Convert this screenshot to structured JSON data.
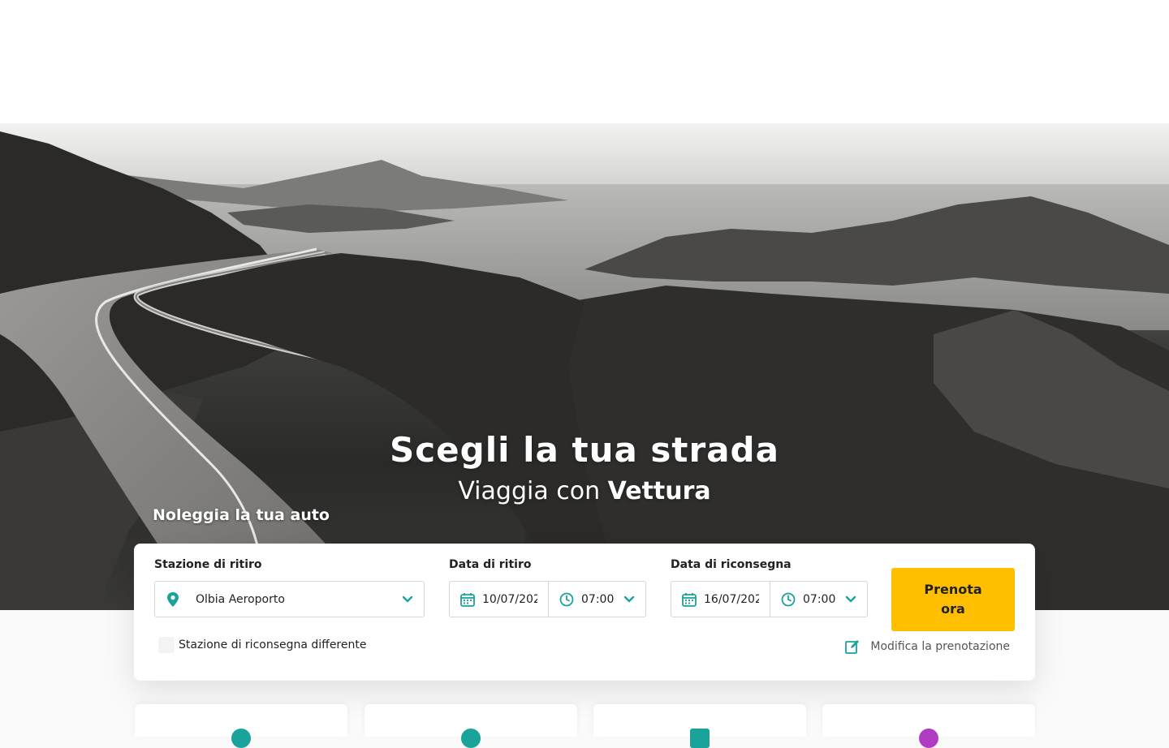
{
  "hero": {
    "title": "Scegli la tua strada",
    "subtitle_prefix": "Viaggia con",
    "subtitle_brand": "Vettura"
  },
  "booking": {
    "section_label": "Noleggia la tua auto",
    "pickup_station": {
      "label": "Stazione di ritiro",
      "value": "Olbia Aeroporto",
      "icon": "map-pin-icon"
    },
    "pickup_date": {
      "label": "Data di ritiro",
      "date": "10/07/202",
      "time": "07:00"
    },
    "return_date": {
      "label": "Data di riconsegna",
      "date": "16/07/202",
      "time": "07:00"
    },
    "submit_label": "Prenota ora",
    "different_station_label": "Stazione di riconsegna differente",
    "modify_label": "Modifica la prenotazione"
  },
  "colors": {
    "accent": "#1aa39a",
    "button": "#ffbf00",
    "card_icons": [
      "#1aa39a",
      "#1aa39a",
      "#1aa39a",
      "#b13cc4"
    ]
  }
}
